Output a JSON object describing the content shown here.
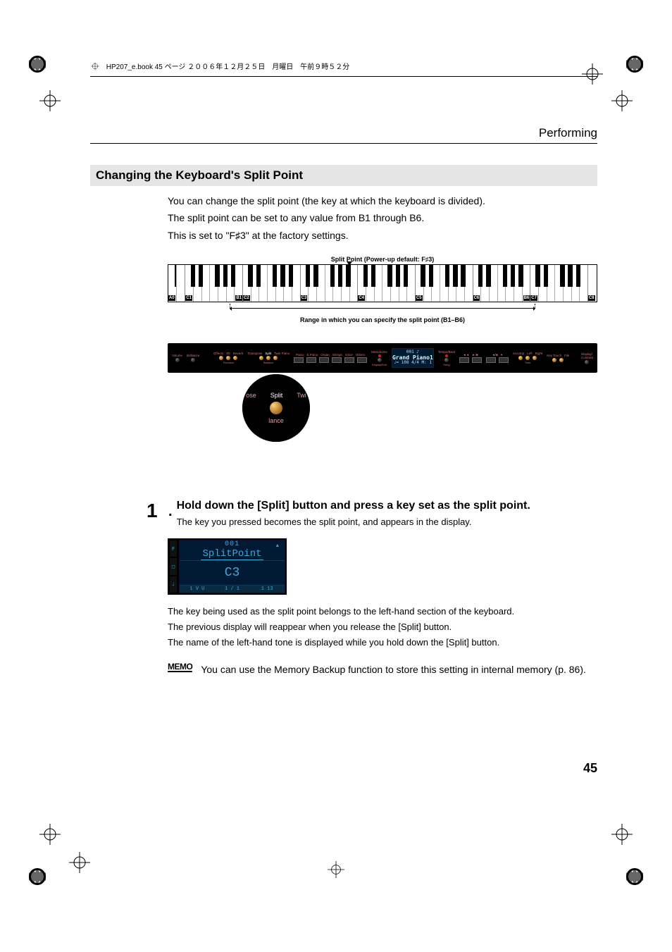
{
  "header": {
    "running_text": "HP207_e.book 45 ページ ２００６年１２月２５日　月曜日　午前９時５２分",
    "section_right": "Performing"
  },
  "subsection": {
    "title": "Changing the Keyboard's Split Point",
    "para1": "You can change the split point (the key at which the keyboard is divided).",
    "para2": "The split point can be set to any value from B1 through B6.",
    "para3_prefix": "This is set to \"F",
    "para3_sharp": "♯",
    "para3_suffix": "3\" at the factory settings."
  },
  "keyboard": {
    "caption_top_prefix": "Split Point (Power-up default: F",
    "caption_top_sharp": "♯",
    "caption_top_suffix": "3)",
    "caption_bottom": "Range in which you can specify the split point (B1–B6)",
    "labels": {
      "a0": "A0",
      "c1": "C1",
      "b1": "B1",
      "c2": "C2",
      "c3": "C3",
      "c4": "C4",
      "c5": "C5",
      "c6": "C6",
      "b6": "B6",
      "c7": "C7",
      "c8": "C8"
    }
  },
  "panel": {
    "labels": {
      "volume": "Volume",
      "brilliance": "Brilliance",
      "effects": "Effects",
      "d3": "3D",
      "reverb": "Reverb",
      "transpose": "Transpose",
      "split": "Split",
      "twinpiano": "Twin Piano",
      "piano": "Piano",
      "epiano": "E.Piano",
      "organ": "Organ",
      "strings": "Strings",
      "voice": "Voice",
      "others": "Others",
      "metronome": "Metronome",
      "tempobeat": "Tempo/Beat",
      "song": "Song",
      "accomp": "Accomp",
      "left": "Left",
      "right": "Right",
      "keytouch": "Key Touch",
      "file": "File",
      "function": "Function",
      "balance": "Balance",
      "display": "Display/Exit",
      "tone": "Tone"
    },
    "lcd": {
      "line1": "001 ♪",
      "line2": "Grand Piano1",
      "line3": "♩= 108    4/4 M:    1"
    },
    "zoom": {
      "left": "ose",
      "center": "Split",
      "right": "Twi",
      "bottom": "lance"
    }
  },
  "step1": {
    "num": "1",
    "title": "Hold down the [Split] button and press a key set as the split point.",
    "line1": "The key you pressed becomes the split point, and appears in the display."
  },
  "screen": {
    "small_num": "001",
    "tri": "▲",
    "title": "SplitPoint",
    "value": "C3",
    "bottom_left": "1 V U",
    "bottom_mid": "1 /   1",
    "bottom_right": "1 13",
    "side_top": "F",
    "side_mid": "□",
    "side_bot": "♩"
  },
  "after": {
    "p1": "The key being used as the split point belongs to the left-hand section of the keyboard.",
    "p2": "The previous display will reappear when you release the [Split] button.",
    "p3": "The name of the left-hand tone is displayed while you hold down the [Split] button."
  },
  "memo": {
    "label": "MEMO",
    "text": "You can use the Memory Backup function to store this setting in internal memory (p. 86)."
  },
  "page_number": "45"
}
